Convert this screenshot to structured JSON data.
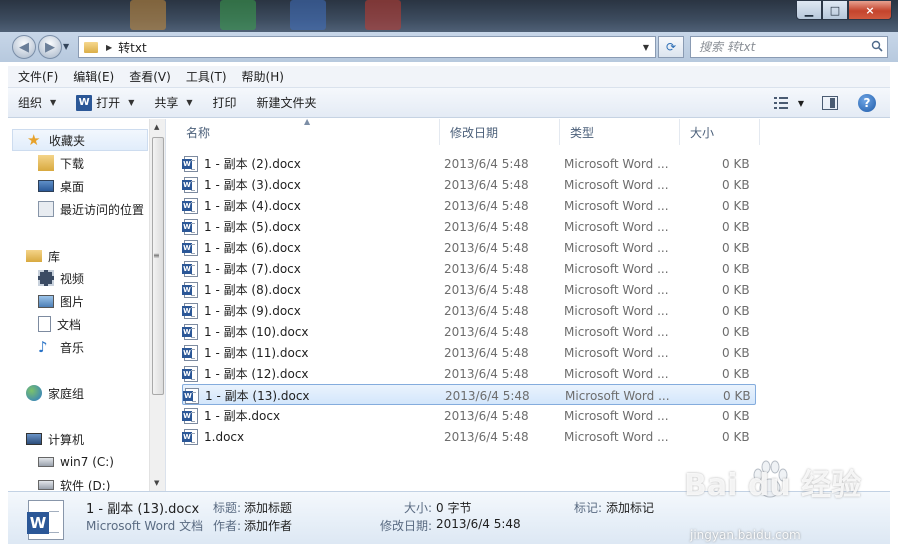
{
  "window": {
    "close_label": "×"
  },
  "address": {
    "breadcrumb": [
      "转txt"
    ]
  },
  "search": {
    "placeholder": "搜索 转txt"
  },
  "menu": [
    "文件(F)",
    "编辑(E)",
    "查看(V)",
    "工具(T)",
    "帮助(H)"
  ],
  "toolbar": {
    "organize": "组织",
    "open": "打开",
    "share": "共享",
    "print": "打印",
    "new_folder": "新建文件夹"
  },
  "nav": {
    "favorites": "收藏夹",
    "favorites_items": [
      "下载",
      "桌面",
      "最近访问的位置"
    ],
    "libraries": "库",
    "libraries_items": [
      "视频",
      "图片",
      "文档",
      "音乐"
    ],
    "homegroup": "家庭组",
    "computer": "计算机",
    "computer_items": [
      "win7 (C:)",
      "软件 (D:)"
    ]
  },
  "columns": {
    "name": "名称",
    "date": "修改日期",
    "type": "类型",
    "size": "大小"
  },
  "files": [
    {
      "name": "1 - 副本 (2).docx",
      "date": "2013/6/4 5:48",
      "type": "Microsoft Word ...",
      "size": "0 KB"
    },
    {
      "name": "1 - 副本 (3).docx",
      "date": "2013/6/4 5:48",
      "type": "Microsoft Word ...",
      "size": "0 KB"
    },
    {
      "name": "1 - 副本 (4).docx",
      "date": "2013/6/4 5:48",
      "type": "Microsoft Word ...",
      "size": "0 KB"
    },
    {
      "name": "1 - 副本 (5).docx",
      "date": "2013/6/4 5:48",
      "type": "Microsoft Word ...",
      "size": "0 KB"
    },
    {
      "name": "1 - 副本 (6).docx",
      "date": "2013/6/4 5:48",
      "type": "Microsoft Word ...",
      "size": "0 KB"
    },
    {
      "name": "1 - 副本 (7).docx",
      "date": "2013/6/4 5:48",
      "type": "Microsoft Word ...",
      "size": "0 KB"
    },
    {
      "name": "1 - 副本 (8).docx",
      "date": "2013/6/4 5:48",
      "type": "Microsoft Word ...",
      "size": "0 KB"
    },
    {
      "name": "1 - 副本 (9).docx",
      "date": "2013/6/4 5:48",
      "type": "Microsoft Word ...",
      "size": "0 KB"
    },
    {
      "name": "1 - 副本 (10).docx",
      "date": "2013/6/4 5:48",
      "type": "Microsoft Word ...",
      "size": "0 KB"
    },
    {
      "name": "1 - 副本 (11).docx",
      "date": "2013/6/4 5:48",
      "type": "Microsoft Word ...",
      "size": "0 KB"
    },
    {
      "name": "1 - 副本 (12).docx",
      "date": "2013/6/4 5:48",
      "type": "Microsoft Word ...",
      "size": "0 KB"
    },
    {
      "name": "1 - 副本 (13).docx",
      "date": "2013/6/4 5:48",
      "type": "Microsoft Word ...",
      "size": "0 KB",
      "selected": true
    },
    {
      "name": "1 - 副本.docx",
      "date": "2013/6/4 5:48",
      "type": "Microsoft Word ...",
      "size": "0 KB"
    },
    {
      "name": "1.docx",
      "date": "2013/6/4 5:48",
      "type": "Microsoft Word ...",
      "size": "0 KB"
    }
  ],
  "details": {
    "filename": "1 - 副本 (13).docx",
    "filetype": "Microsoft Word 文档",
    "title_label": "标题:",
    "title_value": "添加标题",
    "author_label": "作者:",
    "author_value": "添加作者",
    "size_label": "大小:",
    "size_value": "0 字节",
    "modified_label": "修改日期:",
    "modified_value": "2013/6/4 5:48",
    "tags_label": "标记:",
    "tags_value": "添加标记"
  },
  "watermark": {
    "brand": "Bai  du 经验",
    "url": "jingyan.baidu.com"
  },
  "colors": {
    "selection_border": "#84acdd",
    "word_blue": "#2b5797"
  }
}
